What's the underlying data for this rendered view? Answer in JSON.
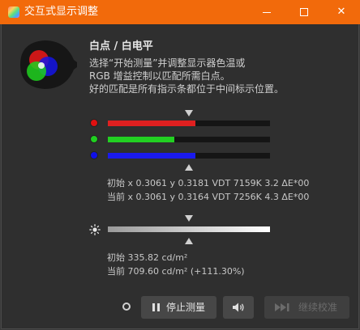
{
  "window": {
    "title": "交互式显示调整"
  },
  "window_controls": {
    "minimize": "minimize",
    "maximize": "maximize",
    "close": "✕"
  },
  "section": {
    "title": "白点 / 白电平"
  },
  "description": [
    "选择“开始测量”并调整显示器色温或",
    "RGB 增益控制以匹配所需白点。",
    "好的匹配是所有指示条都位于中间标示位置。"
  ],
  "rgb_bars": [
    {
      "channel": "red",
      "color": "#e02020",
      "dot_color": "#e01010",
      "level": 0.54
    },
    {
      "channel": "green",
      "color": "#22d022",
      "dot_color": "#20d020",
      "level": 0.41
    },
    {
      "channel": "blue",
      "color": "#1a1aee",
      "dot_color": "#1010e8",
      "level": 0.54
    }
  ],
  "whitepoint": {
    "initial": "初始 x 0.3061 y 0.3181 VDT 7159K 3.2 ΔE*00",
    "current": "当前 x 0.3061 y 0.3164 VDT 7256K 4.3 ΔE*00"
  },
  "luminance": {
    "level": 1.0,
    "initial": "初始 335.82 cd/m²",
    "current": "当前 709.60 cd/m² (+111.30%)"
  },
  "buttons": {
    "stop": "停止测量",
    "continue": "继续校准"
  },
  "icons": {
    "app": "app-icon",
    "rgb_logo": "rgb-circles-icon",
    "brightness": "sun-icon",
    "pause": "pause-icon",
    "sound": "speaker-icon",
    "skip": "skip-forward-icon",
    "status": "status-ring-icon"
  }
}
